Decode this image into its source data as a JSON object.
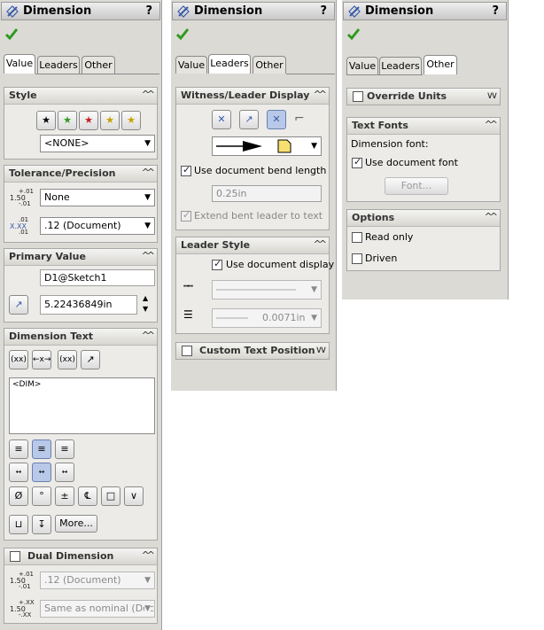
{
  "panel1": {
    "title": "Dimension",
    "help": "?",
    "tabs": [
      "Value",
      "Leaders",
      "Other"
    ],
    "style": {
      "header": "Style",
      "favorite": "<NONE>"
    },
    "tolerance": {
      "header": "Tolerance/Precision",
      "type": "None",
      "precision": ".12 (Document)",
      "icon1_top": "+.01",
      "icon1_mid": "1.50",
      "icon1_bot": "-.01",
      "icon2_top": ".01",
      "icon2_mid": "X.XX",
      "icon2_bot": ".01"
    },
    "primary": {
      "header": "Primary Value",
      "name": "D1@Sketch1",
      "value": "5.22436849in"
    },
    "dimtext": {
      "header": "Dimension Text",
      "content": "<DIM>",
      "btn_xx1": "(xx)",
      "btn_x": "←x→",
      "btn_xx2": "(xx)",
      "more": "More..."
    },
    "dual": {
      "header": "Dual Dimension",
      "precision": ".12 (Document)",
      "tolerance": "Same as nominal (Doc",
      "icon1_top": "+.01",
      "icon1_mid": "1.50",
      "icon1_bot": "-.01",
      "icon2_top": "+.XX",
      "icon2_mid": "1.50",
      "icon2_bot": "-.XX"
    }
  },
  "panel2": {
    "title": "Dimension",
    "help": "?",
    "tabs": [
      "Value",
      "Leaders",
      "Other"
    ],
    "witness": {
      "header": "Witness/Leader Display",
      "use_bend": "Use document bend length",
      "bend_length": "0.25in",
      "extend_bent": "Extend bent leader to text"
    },
    "leader_style": {
      "header": "Leader Style",
      "use_display": "Use document display",
      "thickness": "0.0071in"
    },
    "custom_text": {
      "header": "Custom Text Position"
    }
  },
  "panel3": {
    "title": "Dimension",
    "help": "?",
    "tabs": [
      "Value",
      "Leaders",
      "Other"
    ],
    "override": {
      "header": "Override Units"
    },
    "fonts": {
      "header": "Text Fonts",
      "label": "Dimension font:",
      "use_font": "Use document font",
      "font_btn": "Font..."
    },
    "options": {
      "header": "Options",
      "read_only": "Read only",
      "driven": "Driven"
    }
  },
  "colors": {
    "panel_bg": "#dcdad5",
    "group_bg": "#ecebe7",
    "ok_green": "#2f9a1f",
    "accent_blue": "#3a5aa8"
  }
}
